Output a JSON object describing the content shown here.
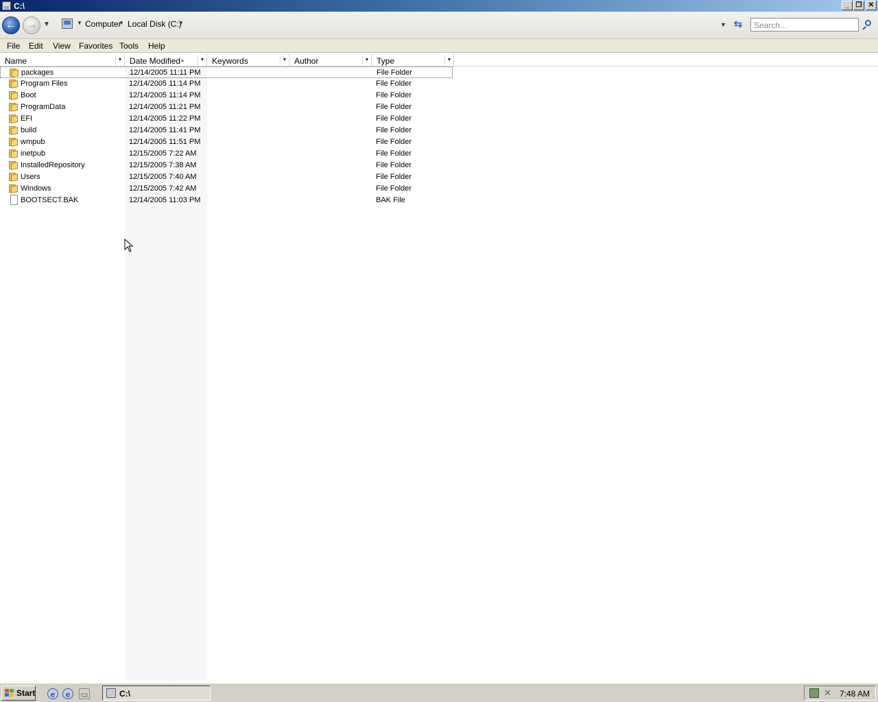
{
  "window": {
    "title": "C:\\"
  },
  "address": {
    "crumbs": [
      "Computer",
      "Local Disk (C:)"
    ],
    "search_placeholder": "Search..."
  },
  "menu": [
    "File",
    "Edit",
    "View",
    "Favorites",
    "Tools",
    "Help"
  ],
  "columns": [
    "Name",
    "Date Modified",
    "Keywords",
    "Author",
    "Type"
  ],
  "sorted_column": "Date Modified",
  "files": [
    {
      "name": "packages",
      "date": "12/14/2005 11:11 PM",
      "type": "File Folder",
      "icon": "folder-icon"
    },
    {
      "name": "Program Files",
      "date": "12/14/2005 11:14 PM",
      "type": "File Folder",
      "icon": "folder-icon"
    },
    {
      "name": "Boot",
      "date": "12/14/2005 11:14 PM",
      "type": "File Folder",
      "icon": "folder-icon"
    },
    {
      "name": "ProgramData",
      "date": "12/14/2005 11:21 PM",
      "type": "File Folder",
      "icon": "folder-icon"
    },
    {
      "name": "EFI",
      "date": "12/14/2005 11:22 PM",
      "type": "File Folder",
      "icon": "folder-icon"
    },
    {
      "name": "build",
      "date": "12/14/2005 11:41 PM",
      "type": "File Folder",
      "icon": "folder-icon"
    },
    {
      "name": "wmpub",
      "date": "12/14/2005 11:51 PM",
      "type": "File Folder",
      "icon": "folder-icon"
    },
    {
      "name": "inetpub",
      "date": "12/15/2005 7:22 AM",
      "type": "File Folder",
      "icon": "folder-icon"
    },
    {
      "name": "InstalledRepository",
      "date": "12/15/2005 7:38 AM",
      "type": "File Folder",
      "icon": "folder-icon"
    },
    {
      "name": "Users",
      "date": "12/15/2005 7:40 AM",
      "type": "File Folder",
      "icon": "folder-icon"
    },
    {
      "name": "Windows",
      "date": "12/15/2005 7:42 AM",
      "type": "File Folder",
      "icon": "folder-icon"
    },
    {
      "name": "BOOTSECT.BAK",
      "date": "12/14/2005 11:03 PM",
      "type": "BAK File",
      "icon": "file-icon"
    }
  ],
  "taskbar": {
    "start_label": "Start",
    "task_label": "C:\\",
    "clock": "7:48 AM"
  }
}
